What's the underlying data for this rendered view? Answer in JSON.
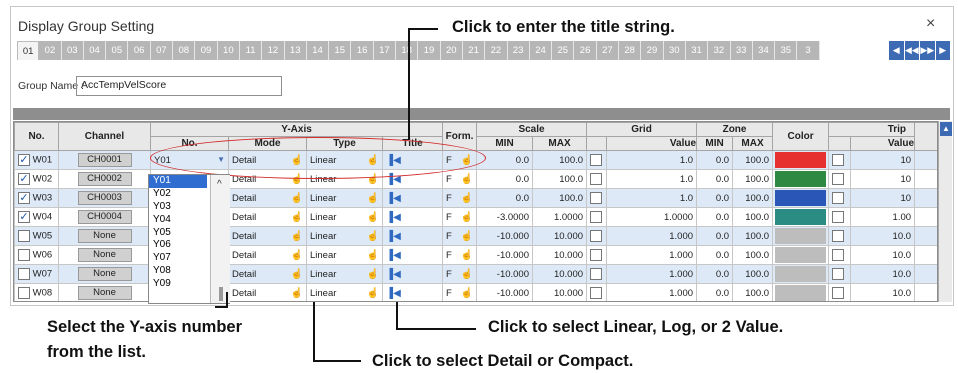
{
  "dialog": {
    "title": "Display Group Setting",
    "close": "×"
  },
  "tabs": [
    "01",
    "02",
    "03",
    "04",
    "05",
    "06",
    "07",
    "08",
    "09",
    "10",
    "11",
    "12",
    "13",
    "14",
    "15",
    "16",
    "17",
    "18",
    "19",
    "20",
    "21",
    "22",
    "23",
    "24",
    "25",
    "26",
    "27",
    "28",
    "29",
    "30",
    "31",
    "32",
    "33",
    "34",
    "35",
    "3"
  ],
  "active_tab": "01",
  "nav": [
    "◀",
    "◀◀",
    "▶▶",
    "▶"
  ],
  "group_name": {
    "label": "Group Name :",
    "value": "AccTempVelScore"
  },
  "headers": {
    "no": "No.",
    "channel": "Channel",
    "yaxis": "Y-Axis",
    "yno": "No.",
    "mode": "Mode",
    "type": "Type",
    "title": "Title",
    "form": "Form.",
    "scale": "Scale",
    "min": "MIN",
    "max": "MAX",
    "grid": "Grid",
    "value": "Value",
    "zone": "Zone",
    "color": "Color",
    "trip": "Trip",
    "trip_value": "Value"
  },
  "rows": [
    {
      "no": "W01",
      "checked": true,
      "channel": "CH0001",
      "yno": "Y01",
      "mode": "Detail",
      "type": "Linear",
      "form": "F",
      "min": "0.0",
      "max": "100.0",
      "grid": "1.0",
      "zmin": "0.0",
      "zmax": "100.0",
      "color": "#e62f2f",
      "trip": "10"
    },
    {
      "no": "W02",
      "checked": true,
      "channel": "CH0002",
      "yno": "",
      "mode": "Detail",
      "type": "Linear",
      "form": "F",
      "min": "0.0",
      "max": "100.0",
      "grid": "1.0",
      "zmin": "0.0",
      "zmax": "100.0",
      "color": "#2e8a42",
      "trip": "10"
    },
    {
      "no": "W03",
      "checked": true,
      "channel": "CH0003",
      "yno": "",
      "mode": "Detail",
      "type": "Linear",
      "form": "F",
      "min": "0.0",
      "max": "100.0",
      "grid": "1.0",
      "zmin": "0.0",
      "zmax": "100.0",
      "color": "#2a56b8",
      "trip": "10"
    },
    {
      "no": "W04",
      "checked": true,
      "channel": "CH0004",
      "yno": "",
      "mode": "Detail",
      "type": "Linear",
      "form": "F",
      "min": "-3.0000",
      "max": "1.0000",
      "grid": "1.0000",
      "zmin": "0.0",
      "zmax": "100.0",
      "color": "#2a8c82",
      "trip": "1.00"
    },
    {
      "no": "W05",
      "checked": false,
      "channel": "None",
      "yno": "",
      "mode": "Detail",
      "type": "Linear",
      "form": "F",
      "min": "-10.000",
      "max": "10.000",
      "grid": "1.000",
      "zmin": "0.0",
      "zmax": "100.0",
      "color": "#bdbdbd",
      "trip": "10.0"
    },
    {
      "no": "W06",
      "checked": false,
      "channel": "None",
      "yno": "",
      "mode": "Detail",
      "type": "Linear",
      "form": "F",
      "min": "-10.000",
      "max": "10.000",
      "grid": "1.000",
      "zmin": "0.0",
      "zmax": "100.0",
      "color": "#bdbdbd",
      "trip": "10.0"
    },
    {
      "no": "W07",
      "checked": false,
      "channel": "None",
      "yno": "",
      "mode": "Detail",
      "type": "Linear",
      "form": "F",
      "min": "-10.000",
      "max": "10.000",
      "grid": "1.000",
      "zmin": "0.0",
      "zmax": "100.0",
      "color": "#bdbdbd",
      "trip": "10.0"
    },
    {
      "no": "W08",
      "checked": false,
      "channel": "None",
      "yno": "",
      "mode": "Detail",
      "type": "Linear",
      "form": "F",
      "min": "-10.000",
      "max": "10.000",
      "grid": "1.000",
      "zmin": "0.0",
      "zmax": "100.0",
      "color": "#bdbdbd",
      "trip": "10.0"
    },
    {
      "no": "W09",
      "checked": false,
      "channel": "None",
      "yno": "",
      "mode": "Detail",
      "type": "Linear",
      "form": "F",
      "min": "-10.000",
      "max": "10.000",
      "grid": "1.000",
      "zmin": "0.0",
      "zmax": "100.0",
      "color": "#bdbdbd",
      "trip": "10.0"
    }
  ],
  "dropdown_options": [
    "Y01",
    "Y02",
    "Y03",
    "Y04",
    "Y05",
    "Y06",
    "Y07",
    "Y08",
    "Y09"
  ],
  "dropdown_selected": "Y01",
  "callouts": {
    "title": "Click to enter the title string.",
    "yaxis_line1": "Select the Y-axis number",
    "yaxis_line2": "from the list.",
    "type": "Click to select Linear, Log, or 2 Value.",
    "mode": "Click to select Detail or Compact."
  }
}
